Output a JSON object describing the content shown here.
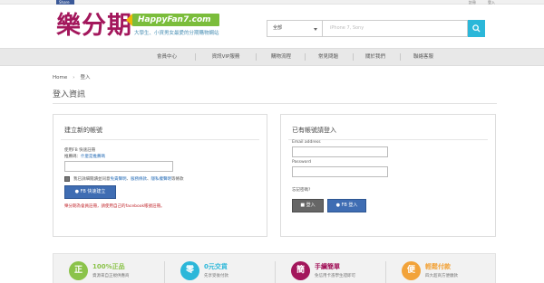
{
  "topbar": {
    "share_label": "Share",
    "links": [
      "註冊",
      "登入"
    ]
  },
  "logo": {
    "brand": "樂分期",
    "badge": "HappyFan7.com",
    "slogan": "大學生、小資男女最愛的分期購物網站"
  },
  "search": {
    "category": "全部",
    "placeholder": "iPhone 7, Sony"
  },
  "nav": {
    "items": [
      "會員中心",
      "資訊VIP服務",
      "購物流程",
      "常見問題",
      "關於我們",
      "聯絡客服"
    ]
  },
  "breadcrumb": {
    "home": "Home",
    "current": "登入"
  },
  "page_title": "登入資訊",
  "register_panel": {
    "title": "建立新的帳號",
    "fb_hint": "使用FB 快速註冊",
    "referral_label": "推薦碼：",
    "referral_link": "什麼是推薦碼",
    "agree_prefix": "我已詳細閱讀並同意",
    "agree_link1": "免責聲明",
    "agree_link2": "服務條款",
    "agree_link3": "隱私權聲明",
    "agree_suffix": "等條款",
    "fb_button": "FB 快速建立",
    "warning": "樂分期為會員註冊，請使用自己的facebook帳號註冊。"
  },
  "login_panel": {
    "title": "已有帳號請登入",
    "email_label": "Email address",
    "password_label": "Password",
    "forgot": "忘記密碼?",
    "login_button": "登入",
    "fb_login_button": "FB 登入"
  },
  "features": [
    {
      "icon": "正",
      "title": "100%正品",
      "desc": "資源來自正規供應商",
      "color": "#8bc34a"
    },
    {
      "icon": "零",
      "title": "0元交貨",
      "desc": "先享受後付款",
      "color": "#2bb7d9"
    },
    {
      "icon": "簡",
      "title": "手續簡單",
      "desc": "免信用卡憑學生證即可",
      "color": "#a3175c"
    },
    {
      "icon": "便",
      "title": "輕鬆付款",
      "desc": "四大超商方便繳款",
      "color": "#f2a33a"
    }
  ]
}
